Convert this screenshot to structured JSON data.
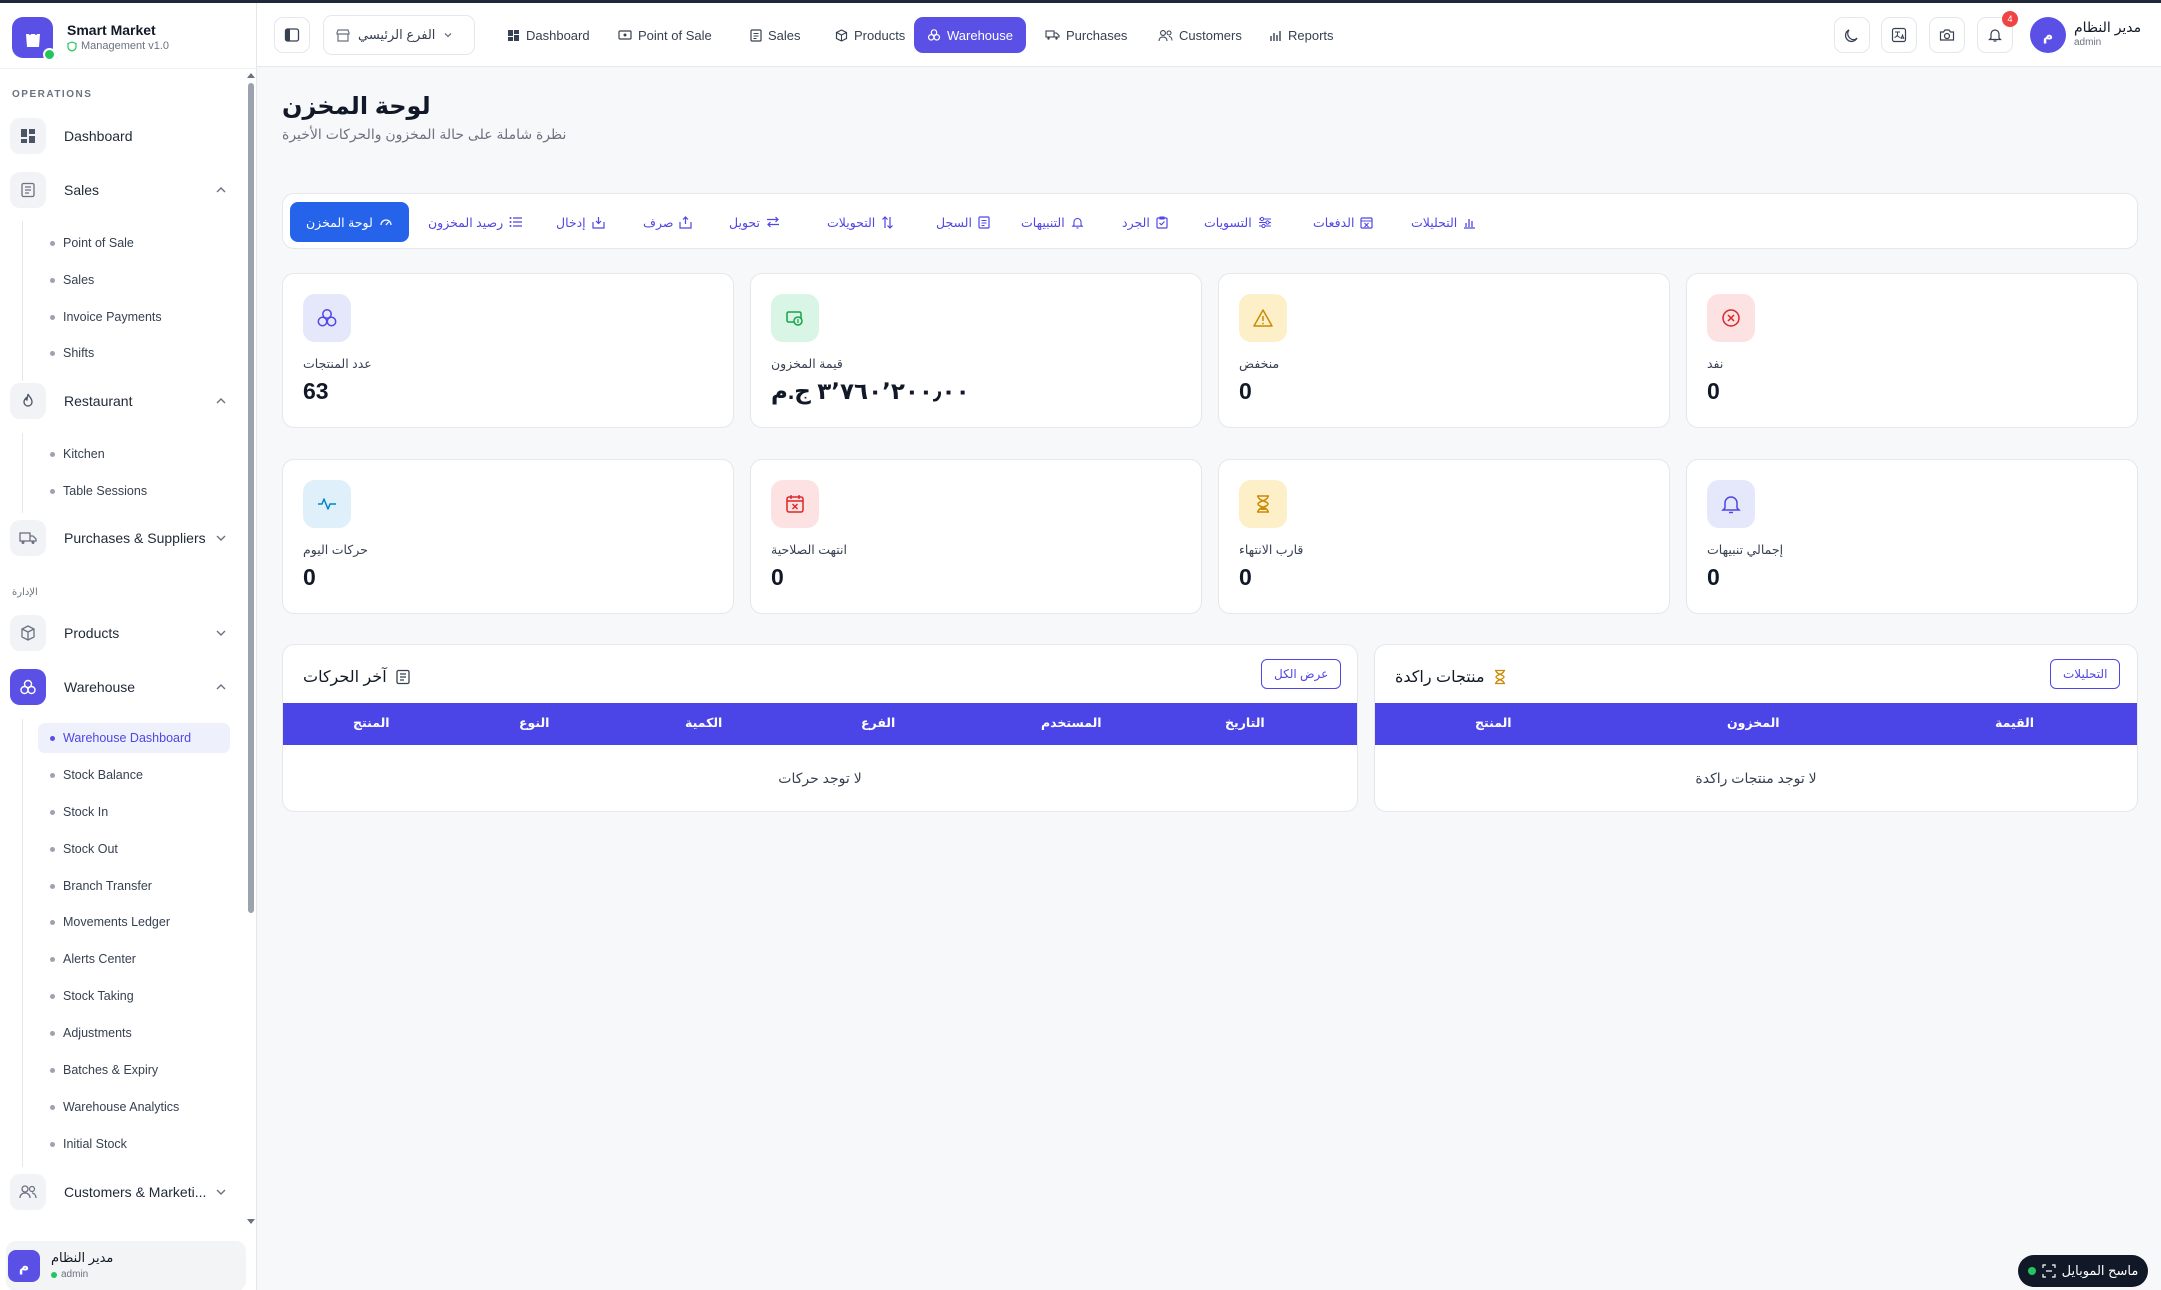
{
  "app": {
    "name": "Smart Market",
    "version": "Management v1.0"
  },
  "sidebar": {
    "sections": {
      "operations": "OPERATIONS",
      "admin": "الإدارة"
    },
    "items": {
      "dashboard": "Dashboard",
      "sales": "Sales",
      "restaurant": "Restaurant",
      "purchases": "Purchases & Suppliers",
      "products": "Products",
      "warehouse": "Warehouse",
      "customers": "Customers & Marketi..."
    },
    "sales_sub": [
      "Point of Sale",
      "Sales",
      "Invoice Payments",
      "Shifts"
    ],
    "restaurant_sub": [
      "Kitchen",
      "Table Sessions"
    ],
    "warehouse_sub": [
      "Warehouse Dashboard",
      "Stock Balance",
      "Stock In",
      "Stock Out",
      "Branch Transfer",
      "Movements Ledger",
      "Alerts Center",
      "Stock Taking",
      "Adjustments",
      "Batches & Expiry",
      "Warehouse Analytics",
      "Initial Stock"
    ],
    "user": {
      "name": "مدير النظام",
      "role": "admin",
      "initial": "م"
    }
  },
  "topbar": {
    "branch": "الفرع الرئيسي",
    "nav": [
      "Dashboard",
      "Point of Sale",
      "Sales",
      "Products",
      "Warehouse",
      "Purchases",
      "Customers",
      "Reports"
    ],
    "notifications_count": "4",
    "user": {
      "name": "مدير النظام",
      "role": "admin",
      "initial": "م"
    }
  },
  "page": {
    "title": "لوحة المخزن",
    "subtitle": "نظرة شاملة على حالة المخزون والحركات الأخيرة"
  },
  "tabs": [
    "لوحة المخزن",
    "رصيد المخزون",
    "إدخال",
    "صرف",
    "تحويل",
    "التحويلات",
    "السجل",
    "التنبيهات",
    "الجرد",
    "التسويات",
    "الدفعات",
    "التحليلات"
  ],
  "stats_row1": [
    {
      "label": "عدد المنتجات",
      "value": "63"
    },
    {
      "label": "قيمة المخزون",
      "value": "٣٬٧٦٠٬٢٠٠٫٠٠ ج.م"
    },
    {
      "label": "منخفض",
      "value": "0"
    },
    {
      "label": "نفد",
      "value": "0"
    }
  ],
  "stats_row2": [
    {
      "label": "حركات اليوم",
      "value": "0"
    },
    {
      "label": "انتهت الصلاحية",
      "value": "0"
    },
    {
      "label": "قارب الانتهاء",
      "value": "0"
    },
    {
      "label": "إجمالي تنبيهات",
      "value": "0"
    }
  ],
  "movements": {
    "title": "آخر الحركات",
    "button": "عرض الكل",
    "columns": [
      "التاريخ",
      "المستخدم",
      "الفرع",
      "الكمية",
      "النوع",
      "المنتج"
    ],
    "empty": "لا توجد حركات"
  },
  "stagnant": {
    "title": "منتجات راكدة",
    "button": "التحليلات",
    "columns": [
      "القيمة",
      "المخزون",
      "المنتج"
    ],
    "empty": "لا توجد منتجات راكدة"
  },
  "mobile_scanner": "ماسح الموبايل",
  "colors": {
    "accent": "#5b50e6",
    "table_header": "#4b44e6",
    "tab_active": "#2563eb"
  }
}
